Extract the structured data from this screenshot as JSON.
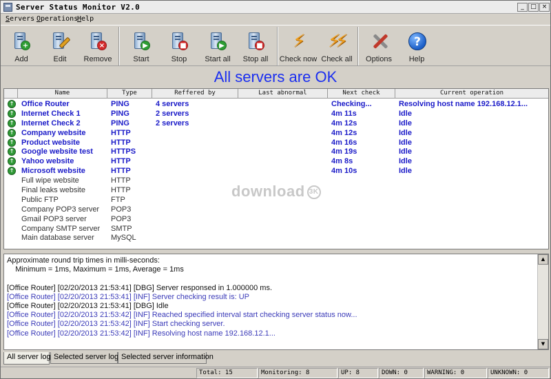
{
  "window": {
    "title": "Server Status Monitor V2.0",
    "minimize": "_",
    "maximize": "□",
    "close": "×"
  },
  "menu": [
    "Servers",
    "Operations",
    "Help"
  ],
  "toolbar": {
    "add": "Add",
    "edit": "Edit",
    "remove": "Remove",
    "start": "Start",
    "stop": "Stop",
    "start_all": "Start all",
    "stop_all": "Stop all",
    "check_now": "Check now",
    "check_all": "Check all",
    "options": "Options",
    "help": "Help"
  },
  "banner": "All servers are OK",
  "table": {
    "headers": [
      "Name",
      "Type",
      "Reffered by",
      "Last abnormal",
      "Next check",
      "Current operation"
    ],
    "rows": [
      {
        "name": "Office Router",
        "type": "PING",
        "ref": "4 servers",
        "last": "",
        "next": "Checking...",
        "op": "Resolving host name 192.168.12.1...",
        "active": true
      },
      {
        "name": "Internet Check 1",
        "type": "PING",
        "ref": "2 servers",
        "last": "",
        "next": "4m 11s",
        "op": "Idle",
        "active": true
      },
      {
        "name": "Internet Check 2",
        "type": "PING",
        "ref": "2 servers",
        "last": "",
        "next": "4m 12s",
        "op": "Idle",
        "active": true
      },
      {
        "name": "Company website",
        "type": "HTTP",
        "ref": "",
        "last": "",
        "next": "4m 12s",
        "op": "Idle",
        "active": true
      },
      {
        "name": "Product website",
        "type": "HTTP",
        "ref": "",
        "last": "",
        "next": "4m 16s",
        "op": "Idle",
        "active": true
      },
      {
        "name": "Google website test",
        "type": "HTTPS",
        "ref": "",
        "last": "",
        "next": "4m 19s",
        "op": "Idle",
        "active": true
      },
      {
        "name": "Yahoo website",
        "type": "HTTP",
        "ref": "",
        "last": "",
        "next": "4m 8s",
        "op": "Idle",
        "active": true
      },
      {
        "name": "Microsoft website",
        "type": "HTTP",
        "ref": "",
        "last": "",
        "next": "4m 10s",
        "op": "Idle",
        "active": true
      },
      {
        "name": "Full wipe website",
        "type": "HTTP",
        "ref": "",
        "last": "",
        "next": "",
        "op": "",
        "active": false
      },
      {
        "name": "Final leaks website",
        "type": "HTTP",
        "ref": "",
        "last": "",
        "next": "",
        "op": "",
        "active": false
      },
      {
        "name": "Public FTP",
        "type": "FTP",
        "ref": "",
        "last": "",
        "next": "",
        "op": "",
        "active": false
      },
      {
        "name": "Company POP3 server",
        "type": "POP3",
        "ref": "",
        "last": "",
        "next": "",
        "op": "",
        "active": false
      },
      {
        "name": "Gmail POP3 server",
        "type": "POP3",
        "ref": "",
        "last": "",
        "next": "",
        "op": "",
        "active": false
      },
      {
        "name": "Company SMTP server",
        "type": "SMTP",
        "ref": "",
        "last": "",
        "next": "",
        "op": "",
        "active": false
      },
      {
        "name": "Main database server",
        "type": "MySQL",
        "ref": "",
        "last": "",
        "next": "",
        "op": "",
        "active": false
      }
    ]
  },
  "watermark": {
    "text": "download",
    "badge": "3K"
  },
  "log": [
    {
      "text": "Approximate round trip times in milli-seconds:",
      "color": "black"
    },
    {
      "text": "    Minimum = 1ms, Maximum = 1ms, Average = 1ms",
      "color": "black"
    },
    {
      "text": "",
      "color": "empty"
    },
    {
      "text": "[Office Router] [02/20/2013 21:53:41] [DBG] Server responsed in 1.000000 ms.",
      "color": "black"
    },
    {
      "text": "[Office Router] [02/20/2013 21:53:41] [INF] Server checking result is: UP",
      "color": "blue"
    },
    {
      "text": "[Office Router] [02/20/2013 21:53:41] [DBG] Idle",
      "color": "black"
    },
    {
      "text": "[Office Router] [02/20/2013 21:53:42] [INF] Reached specified interval start checking server status now...",
      "color": "blue"
    },
    {
      "text": "[Office Router] [02/20/2013 21:53:42] [INF] Start checking server.",
      "color": "blue"
    },
    {
      "text": "[Office Router] [02/20/2013 21:53:42] [INF] Resolving host name 192.168.12.1...",
      "color": "blue"
    }
  ],
  "tabs": [
    "All server log",
    "Selected server log",
    "Selected server information"
  ],
  "status": {
    "total": "Total: 15",
    "monitoring": "Monitoring: 8",
    "up": "UP: 8",
    "down": "DOWN: 0",
    "warning": "WARNING: 0",
    "unknown": "UNKNOWN: 0"
  },
  "colors": {
    "banner": "#1a2ef0",
    "active_row": "#1a1ac8",
    "log_info": "#3a3ab8",
    "up_icon": "#2f9a36"
  }
}
